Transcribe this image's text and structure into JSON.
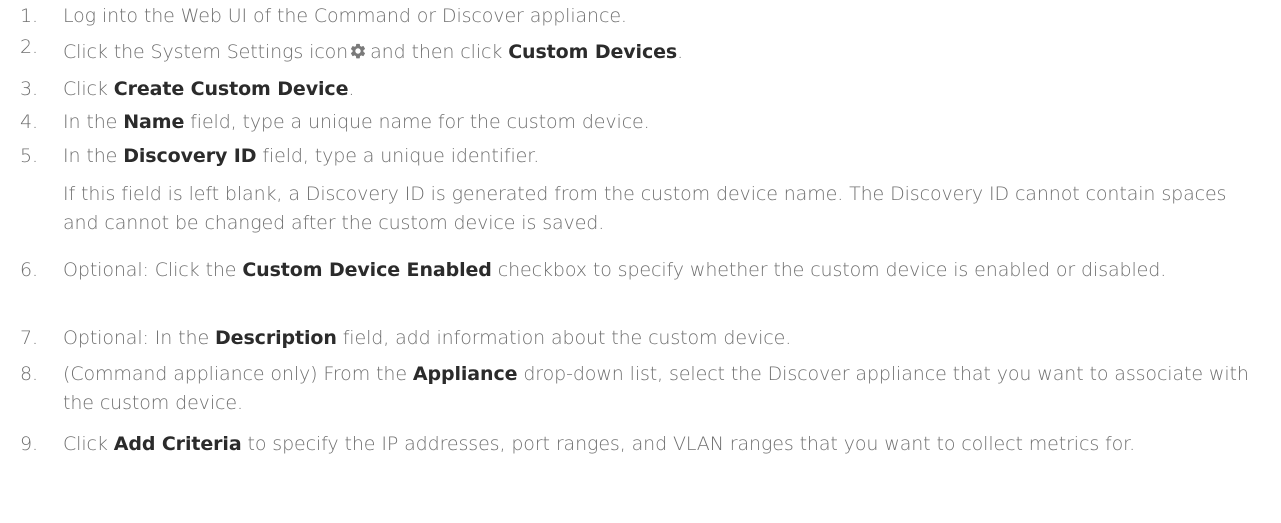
{
  "steps": [
    {
      "num": "1.",
      "parts": [
        {
          "t": "Log into the Web UI of the Command or Discover appliance.",
          "b": false
        }
      ]
    },
    {
      "num": "2.",
      "parts": [
        {
          "t": "Click the System Settings icon",
          "b": false
        },
        {
          "icon": "gear-icon"
        },
        {
          "t": "and then click ",
          "b": false
        },
        {
          "t": "Custom Devices",
          "b": true
        },
        {
          "t": ".",
          "b": false
        }
      ]
    },
    {
      "num": "3.",
      "parts": [
        {
          "t": "Click ",
          "b": false
        },
        {
          "t": "Create Custom Device",
          "b": true
        },
        {
          "t": ".",
          "b": false
        }
      ]
    },
    {
      "num": "4.",
      "parts": [
        {
          "t": "In the ",
          "b": false
        },
        {
          "t": "Name",
          "b": true
        },
        {
          "t": " field, type a unique name for the custom device.",
          "b": false
        }
      ]
    },
    {
      "num": "5.",
      "parts": [
        {
          "t": "In the ",
          "b": false
        },
        {
          "t": "Discovery ID",
          "b": true
        },
        {
          "t": " field, type a unique identifier.",
          "b": false
        }
      ]
    },
    {
      "num": "",
      "note": true,
      "parts": [
        {
          "t": "If this field is left blank, a Discovery ID is generated from the custom device name. The Discovery ID cannot contain spaces and cannot be changed after the custom device is saved.",
          "b": false
        }
      ]
    },
    {
      "num": "6.",
      "parts": [
        {
          "t": "Optional: Click the ",
          "b": false
        },
        {
          "t": "Custom Device Enabled",
          "b": true
        },
        {
          "t": " checkbox to specify whether the custom device is enabled or disabled.",
          "b": false
        }
      ]
    },
    {
      "num": "7.",
      "parts": [
        {
          "t": "Optional: In the ",
          "b": false
        },
        {
          "t": "Description",
          "b": true
        },
        {
          "t": " field, add information about the custom device.",
          "b": false
        }
      ]
    },
    {
      "num": "8.",
      "parts": [
        {
          "t": "(Command appliance only) From the ",
          "b": false
        },
        {
          "t": "Appliance",
          "b": true
        },
        {
          "t": " drop-down list, select the Discover appliance that you want to associate with the custom device.",
          "b": false
        }
      ]
    },
    {
      "num": "9.",
      "parts": [
        {
          "t": "Click ",
          "b": false
        },
        {
          "t": "Add Criteria",
          "b": true
        },
        {
          "t": " to specify the IP addresses, port ranges, and VLAN ranges that you want to collect metrics for.",
          "b": false
        }
      ]
    }
  ],
  "colors": {
    "text": "#6f6f6f",
    "keyword": "#2b2b2b",
    "icon": "#7a7a7a"
  }
}
